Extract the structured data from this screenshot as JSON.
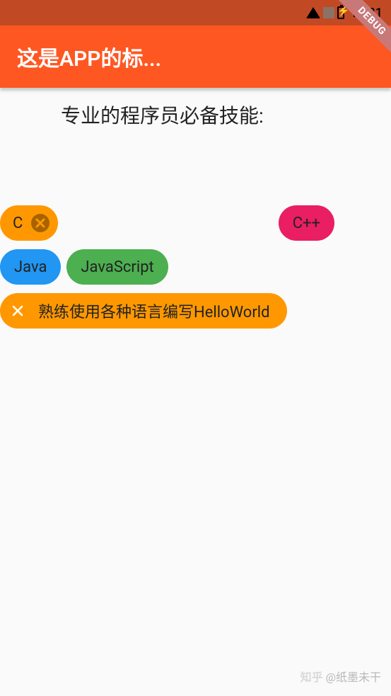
{
  "status_bar": {
    "time": "10:31"
  },
  "app_bar": {
    "title": "这是APP的标..."
  },
  "debug_banner": "DEBUG",
  "heading": "专业的程序员必备技能:",
  "chips": {
    "c": "C",
    "cpp": "C++",
    "java": "Java",
    "javascript": "JavaScript",
    "helloworld": "熟练使用各种语言编写HelloWorld"
  },
  "watermark": {
    "brand": "知乎",
    "author": "@纸墨未干"
  }
}
